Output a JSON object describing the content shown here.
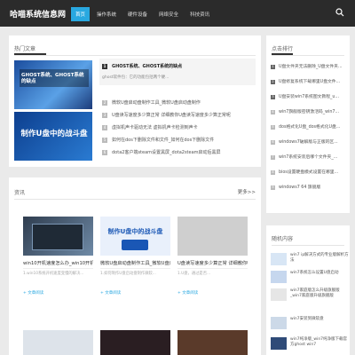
{
  "site": {
    "title": "哈喵系统信息网"
  },
  "nav": [
    {
      "label": "首页"
    },
    {
      "label": "操作系统"
    },
    {
      "label": "硬件设备"
    },
    {
      "label": "网络安全"
    },
    {
      "label": "科技资讯"
    }
  ],
  "hot": {
    "title": "热门文章",
    "featured_img_text1": "GHOST系统、GHOST系统的缺点",
    "featured_img_text2": "制作U盘中的战斗盘",
    "items": [
      {
        "num": "1",
        "text": "GHOST系统、GHOST系统的缺点"
      },
      {
        "num": "2",
        "text": "微软U盘启动盘制作工具_微软U盘启动盘制作"
      },
      {
        "num": "3",
        "text": "U盘读写速度多少算正常 详细教你U盘读写速度多少算正常呢"
      },
      {
        "num": "4",
        "text": "虚拟机声卡驱动无法 虚拟机声卡检测到声卡"
      },
      {
        "num": "5",
        "text": "如何在dos下删除文件和文件_如何在dos下删除文件"
      },
      {
        "num": "6",
        "text": "dota2客户端steam设置黑屏_dota2steam启动后黑屏"
      }
    ],
    "first_desc": "ghost软件包：它的功能包括两个硬..."
  },
  "sidebar": {
    "title": "点击排行",
    "items": [
      {
        "num": "1",
        "text": "U盘文件夹无法删除_U盘文件夹..."
      },
      {
        "num": "2",
        "text": "U盘修复系统下载哪里U盘文件..."
      },
      {
        "num": "3",
        "text": "U盘安装win7系统图文教程_u..."
      },
      {
        "num": "4",
        "text": "win7旗舰版密钥激活码_win7..."
      },
      {
        "num": "5",
        "text": "dos格式化U盘_dos格式化U盘..."
      },
      {
        "num": "6",
        "text": "windows7破解版与正版的区..."
      },
      {
        "num": "7",
        "text": "win7系统安装后哪个文件夹_..."
      },
      {
        "num": "8",
        "text": "bios设置硬盘模式设置在哪里..."
      },
      {
        "num": "9",
        "text": "windows7 64 旗舰版"
      }
    ]
  },
  "random": {
    "title": "随机内容",
    "items": [
      {
        "text": "win7 ip解决方式的专业版解析方法"
      },
      {
        "text": "win7系统怎么设置U盘启动"
      },
      {
        "text": "win7家庭版怎么升级旗舰版_win7家庭版升级旗舰版"
      },
      {
        "text": "win7安装到微软盘"
      },
      {
        "text": "win7纯净版_win7纯净版下载官方ghost win7"
      }
    ]
  },
  "latest": {
    "title": "资讯",
    "more": "更多>>",
    "posts": [
      {
        "title": "win10开机速度怎么办_win10开机速度",
        "desc": "1.win10系统开机速度变慢的解决...",
        "more": "+ 文章阅读",
        "img_label": ""
      },
      {
        "title": "微软U盘启动盘制作工具_微软U盘启动盘",
        "desc": "1.如何制作U盘启动盘制作微软...",
        "more": "+ 文章阅读",
        "img_label": "制作U盘中的战斗盘"
      },
      {
        "title": "U盘读写速度多少算正常 详细教你U盘",
        "desc": "1.U盘，通过是否...",
        "more": "+ 文章阅读",
        "img_label": ""
      }
    ]
  },
  "colors": {
    "accent": "#29a8e0",
    "topbar": "#2b2b2b"
  }
}
